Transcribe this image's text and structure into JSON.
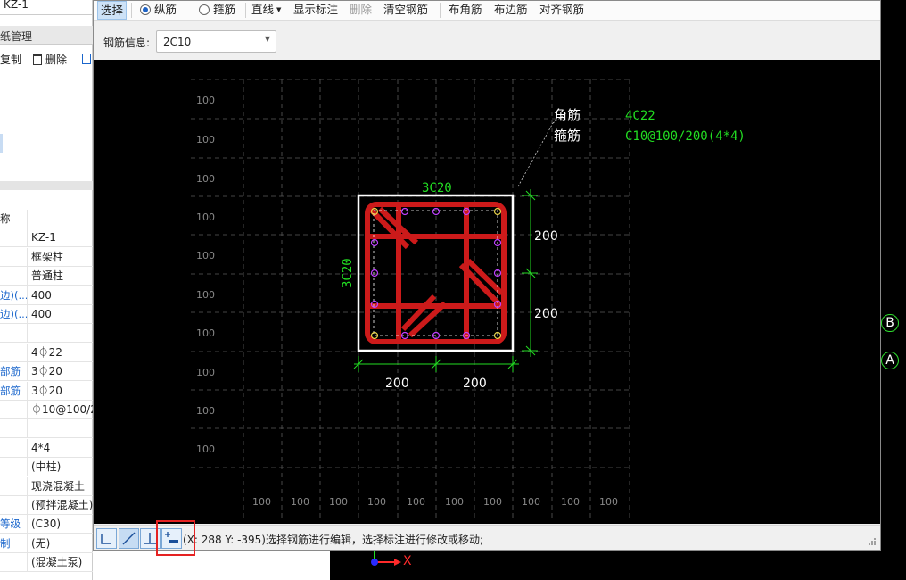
{
  "left_panel": {
    "top_select": "KZ-1",
    "tab": "纸管理",
    "copy_label": "复制",
    "delete_label": "删除",
    "props": [
      {
        "name": "称",
        "value": "",
        "blue": false
      },
      {
        "name": "",
        "value": "KZ-1",
        "blue": false
      },
      {
        "name": "",
        "value": "框架柱",
        "blue": false
      },
      {
        "name": "",
        "value": "普通柱",
        "blue": false
      },
      {
        "name": "边)(...",
        "value": "400",
        "blue": true
      },
      {
        "name": "边)(...",
        "value": "400",
        "blue": true
      },
      {
        "name": "",
        "value": "",
        "blue": false
      },
      {
        "name": "",
        "value": "4⏀22",
        "blue": false
      },
      {
        "name": "部筋",
        "value": "3⏀20",
        "blue": true
      },
      {
        "name": "部筋",
        "value": "3⏀20",
        "blue": true
      },
      {
        "name": "",
        "value": "⏀10@100/2",
        "blue": false
      },
      {
        "name": "",
        "value": "",
        "blue": false
      },
      {
        "name": "",
        "value": "4*4",
        "blue": false
      },
      {
        "name": "",
        "value": "(中柱)",
        "blue": false
      },
      {
        "name": "",
        "value": "现浇混凝土",
        "blue": false
      },
      {
        "name": "",
        "value": "(预拌混凝土)",
        "blue": false
      },
      {
        "name": "等级",
        "value": "(C30)",
        "blue": true
      },
      {
        "name": "制",
        "value": "(无)",
        "blue": true
      },
      {
        "name": "",
        "value": "(混凝土泵)",
        "blue": false
      }
    ]
  },
  "toolbar": {
    "select": "选择",
    "longitudinal": "纵筋",
    "stirrup": "箍筋",
    "line": "直线",
    "show_annotation": "显示标注",
    "delete": "删除",
    "clear": "清空钢筋",
    "corner_bar": "布角筋",
    "edge_bar": "布边筋",
    "align_bar": "对齐钢筋"
  },
  "rebar_info": {
    "label": "钢筋信息:",
    "value": "2C10"
  },
  "drawing": {
    "grid_label": "100",
    "corner_bar_label": "角筋",
    "corner_bar_value": "4C22",
    "stirrup_label": "箍筋",
    "stirrup_value": "C10@100/200(4*4)",
    "top_bar": "3C20",
    "side_bar": "3C20",
    "dim_value": "200"
  },
  "status": {
    "text": "(X: 288 Y: -395)选择钢筋进行编辑，选择标注进行修改或移动;"
  },
  "axis": {
    "b": "B",
    "a": "A",
    "x_label": "X"
  },
  "colors": {
    "grid": "#5a5a5a",
    "rebar": "#cc1a1a",
    "annotation": "#22dd22",
    "highlight": "#e52222"
  }
}
